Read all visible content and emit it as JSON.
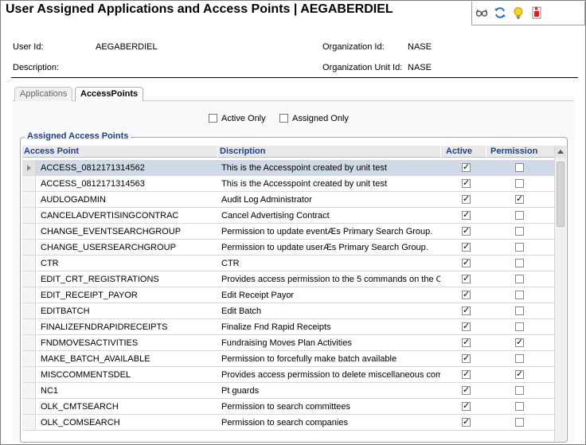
{
  "window": {
    "title": "User Assigned Applications and Access Points  |  AEGABERDIEL"
  },
  "toolbar": {
    "icons": [
      "glasses-icon",
      "refresh-icon",
      "lightbulb-icon",
      "bookmark-icon"
    ]
  },
  "info": {
    "user_id_label": "User Id:",
    "user_id_value": "AEGABERDIEL",
    "description_label": "Description:",
    "org_id_label": "Organization Id:",
    "org_id_value": "NASE",
    "org_unit_label": "Organization Unit Id:",
    "org_unit_value": "NASE"
  },
  "tabs": [
    {
      "label": "Applications",
      "selected": false
    },
    {
      "label": "AccessPoints",
      "selected": true
    }
  ],
  "filters": {
    "active_only": "Active Only",
    "assigned_only": "Assigned Only"
  },
  "group": {
    "title": "Assigned Access Points"
  },
  "grid": {
    "columns": [
      "Access Point",
      "Discription",
      "Active",
      "Permission"
    ],
    "rows": [
      {
        "access_point": "ACCESS_0812171314562",
        "description": "This is the Accesspoint created by unit test",
        "active": true,
        "permission": false,
        "selected": true
      },
      {
        "access_point": "ACCESS_0812171314563",
        "description": "This is the Accesspoint created by unit test",
        "active": true,
        "permission": false
      },
      {
        "access_point": "AUDLOGADMIN",
        "description": "Audit Log Administrator",
        "active": true,
        "permission": true
      },
      {
        "access_point": "CANCELADVERTISINGCONTRAC",
        "description": "Cancel Advertising Contract",
        "active": true,
        "permission": false
      },
      {
        "access_point": "CHANGE_EVENTSEARCHGROUP",
        "description": "Permission to update eventÆs Primary Search Group.",
        "active": true,
        "permission": false
      },
      {
        "access_point": "CHANGE_USERSEARCHGROUP",
        "description": "Permission to update userÆs Primary Search Group.",
        "active": true,
        "permission": false
      },
      {
        "access_point": "CTR",
        "description": "CTR",
        "active": true,
        "permission": false
      },
      {
        "access_point": "EDIT_CRT_REGISTRATIONS",
        "description": "Provides access permission to the 5 commands on the C",
        "active": true,
        "permission": false
      },
      {
        "access_point": "EDIT_RECEIPT_PAYOR",
        "description": "Edit Receipt Payor",
        "active": true,
        "permission": false
      },
      {
        "access_point": "EDITBATCH",
        "description": "Edit Batch",
        "active": true,
        "permission": false
      },
      {
        "access_point": "FINALIZEFNDRAPIDRECEIPTS",
        "description": "Finalize Fnd Rapid Receipts",
        "active": true,
        "permission": false
      },
      {
        "access_point": "FNDMOVESACTIVITIES",
        "description": "Fundraising Moves Plan Activities",
        "active": true,
        "permission": true
      },
      {
        "access_point": "MAKE_BATCH_AVAILABLE",
        "description": "Permission to forcefully make batch available",
        "active": true,
        "permission": false
      },
      {
        "access_point": "MISCCOMMENTSDEL",
        "description": "Provides access permission to delete miscellaneous com",
        "active": true,
        "permission": true
      },
      {
        "access_point": "NC1",
        "description": "Pt guards",
        "active": true,
        "permission": false
      },
      {
        "access_point": "OLK_CMTSEARCH",
        "description": "Permission to search committees",
        "active": true,
        "permission": false
      },
      {
        "access_point": "OLK_COMSEARCH",
        "description": "Permission to search companies",
        "active": true,
        "permission": false
      }
    ]
  },
  "colors": {
    "header_text": "#1f3f8f",
    "selected_row": "#cfd9e8"
  }
}
